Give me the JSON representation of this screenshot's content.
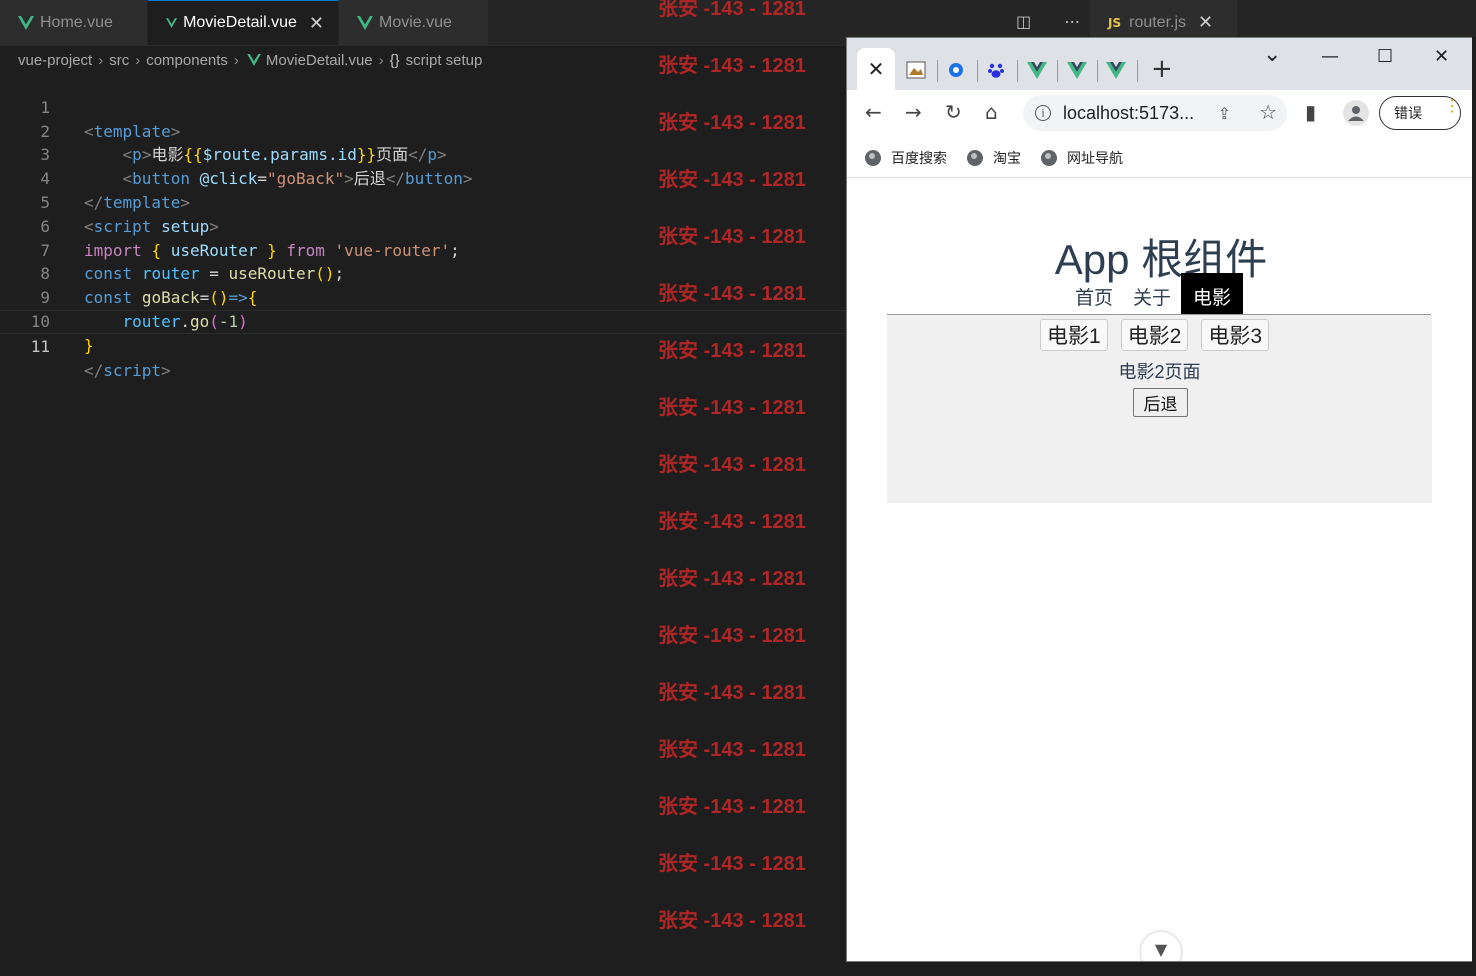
{
  "editor": {
    "tabs": [
      {
        "label": "Home.vue"
      },
      {
        "label": "MovieDetail.vue",
        "close": "✕"
      },
      {
        "label": "Movie.vue"
      },
      {
        "label": "router.js",
        "icon_text": "JS",
        "close": "✕"
      }
    ],
    "split_icons": "◫ ⋯",
    "breadcrumb": [
      "vue-project",
      "src",
      "components",
      "MovieDetail.vue",
      "script setup"
    ],
    "breadcrumb_braces": "{}",
    "line_numbers": [
      "1",
      "2",
      "3",
      "4",
      "5",
      "6",
      "7",
      "8",
      "9",
      "10",
      "11"
    ],
    "code": {
      "l1_open": "<",
      "l1_tag": "template",
      "l1_close": ">",
      "l2_indent": "    ",
      "l2_open": "<",
      "l2_tag": "p",
      "l2_close": ">",
      "l2_text1": "电影",
      "l2_mus_open": "{{",
      "l2_expr": "$route.params.id",
      "l2_mus_close": "}}",
      "l2_text2": "页面",
      "l2_end_open": "</",
      "l2_end_tag": "p",
      "l2_end_close": ">",
      "l3_indent": "    ",
      "l3_open": "<",
      "l3_tag": "button",
      "l3_attr": "@click",
      "l3_eq": "=",
      "l3_val": "\"goBack\"",
      "l3_close": ">",
      "l3_text": "后退",
      "l3_end_open": "</",
      "l3_end_tag": "button",
      "l3_end_close": ">",
      "l4_open": "</",
      "l4_tag": "template",
      "l4_close": ">",
      "l5_open": "<",
      "l5_tag": "script",
      "l5_attr": "setup",
      "l5_close": ">",
      "l6_import": "import",
      "l6_b1": "{",
      "l6_name": "useRouter",
      "l6_b2": "}",
      "l6_from": "from",
      "l6_str": "'vue-router'",
      "l6_semi": ";",
      "l7_const": "const",
      "l7_var": "router",
      "l7_eq": " = ",
      "l7_fn": "useRouter",
      "l7_paren": "()",
      "l7_semi": ";",
      "l8_const": "const",
      "l8_var": "goBack",
      "l8_eq": "=",
      "l8_paren": "()",
      "l8_arrow": "=>",
      "l8_brace": "{",
      "l9_indent": "    ",
      "l9_obj": "router",
      "l9_dot": ".",
      "l9_fn": "go",
      "l9_p1": "(",
      "l9_num": "-1",
      "l9_p2": ")",
      "l10_brace": "}",
      "l11_open": "</",
      "l11_tag": "script",
      "l11_close": ">"
    }
  },
  "watermark": "张安 -143 - 1281",
  "browser": {
    "tab_close": "✕",
    "new_tab": "+",
    "tab_dropdown": "⌄",
    "window_controls": {
      "minimize": "—",
      "maximize": "☐",
      "close": "✕"
    },
    "nav_icons": {
      "back": "←",
      "forward": "→",
      "reload": "↻",
      "home": "⌂"
    },
    "url": "localhost:5173...",
    "info_icon": "i",
    "share_icon": "⇪",
    "star_icon": "☆",
    "sidepanel_icon": "▮",
    "error_button": "错误",
    "bookmarks": [
      "百度搜索",
      "淘宝",
      "网址导航"
    ]
  },
  "page": {
    "title": "App 根组件",
    "nav": [
      "首页",
      "关于",
      "电影"
    ],
    "active_nav": "电影",
    "movie_buttons": [
      "电影1",
      "电影2",
      "电影3"
    ],
    "detail_text": "电影2页面",
    "back_button": "后退",
    "devtools_badge": "▼"
  }
}
